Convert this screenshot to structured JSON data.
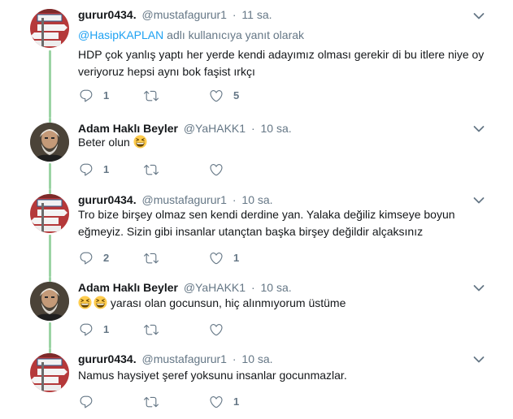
{
  "tweets": [
    {
      "name": "gurur0434.",
      "handle": "@mustafagurur1",
      "dot": "·",
      "time": "11 sa.",
      "reply_mention": "@HasipKAPLAN",
      "reply_suffix": " adlı kullanıcıya yanıt olarak",
      "text": "HDP çok yanlış yaptı her yerde kendi adayımız olması gerekir di bu itlere niye oy veriyoruz hepsi aynı bok faşist ırkçı",
      "reply_count": "1",
      "retweet_count": "",
      "like_count": "5"
    },
    {
      "name": "Adam Haklı Beyler",
      "handle": "@YaHAKK1",
      "dot": "·",
      "time": "10 sa.",
      "text": "Beter olun",
      "emoji": [
        "grinning-squinting-face"
      ],
      "reply_count": "1",
      "retweet_count": "",
      "like_count": ""
    },
    {
      "name": "gurur0434.",
      "handle": "@mustafagurur1",
      "dot": "·",
      "time": "10 sa.",
      "text": "Tro bize birşey olmaz sen kendi derdine yan.  Yalaka değiliz kimseye boyun eğmeyiz. Sizin gibi insanlar utançtan başka birşey değildir alçaksınız",
      "reply_count": "2",
      "retweet_count": "",
      "like_count": "1"
    },
    {
      "name": "Adam Haklı Beyler",
      "handle": "@YaHAKK1",
      "dot": "·",
      "time": "10 sa.",
      "emoji": [
        "grinning-squinting-face",
        "grinning-squinting-face"
      ],
      "text": " yarası olan gocunsun, hiç alınmıyorum üstüme",
      "reply_count": "1",
      "retweet_count": "",
      "like_count": ""
    },
    {
      "name": "gurur0434.",
      "handle": "@mustafagurur1",
      "dot": "·",
      "time": "10 sa.",
      "text": "Namus haysiyet şeref yoksunu insanlar gocunmazlar.",
      "reply_count": "",
      "retweet_count": "",
      "like_count": "1"
    }
  ],
  "avatar_sign_words": [
    "SEVGİLİ",
    "İSTANBUL",
    "ZANDIR",
    "TROLLDI"
  ],
  "colors": {
    "accent": "#1da1f2",
    "muted": "#657786",
    "thread_line": "#9bd4a4",
    "divider": "#e6ecf0"
  }
}
